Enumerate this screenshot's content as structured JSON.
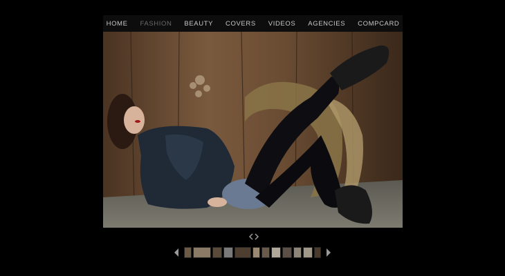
{
  "nav": {
    "items": [
      {
        "label": "HOME",
        "active": false
      },
      {
        "label": "FASHION",
        "active": true
      },
      {
        "label": "BEAUTY",
        "active": false
      },
      {
        "label": "COVERS",
        "active": false
      },
      {
        "label": "VIDEOS",
        "active": false
      },
      {
        "label": "AGENCIES",
        "active": false
      },
      {
        "label": "COMPCARD",
        "active": false
      }
    ]
  },
  "photo": {
    "icon": "fashion-photo"
  },
  "pager": {
    "icon": "prev-next-chevrons-icon"
  },
  "thumbnails": {
    "count": 12,
    "colors": [
      "#6d5a46",
      "#8a7a66",
      "#5a4a3a",
      "#7a7a7a",
      "#4e3e30",
      "#9a8a74",
      "#6a5a4c",
      "#b0a89a",
      "#5c5046",
      "#8e8676",
      "#a09888",
      "#4a3a2e"
    ]
  },
  "colors": {
    "bg": "#000000",
    "nav_text": "#c9c9c9",
    "nav_active": "#6b6b6b"
  }
}
